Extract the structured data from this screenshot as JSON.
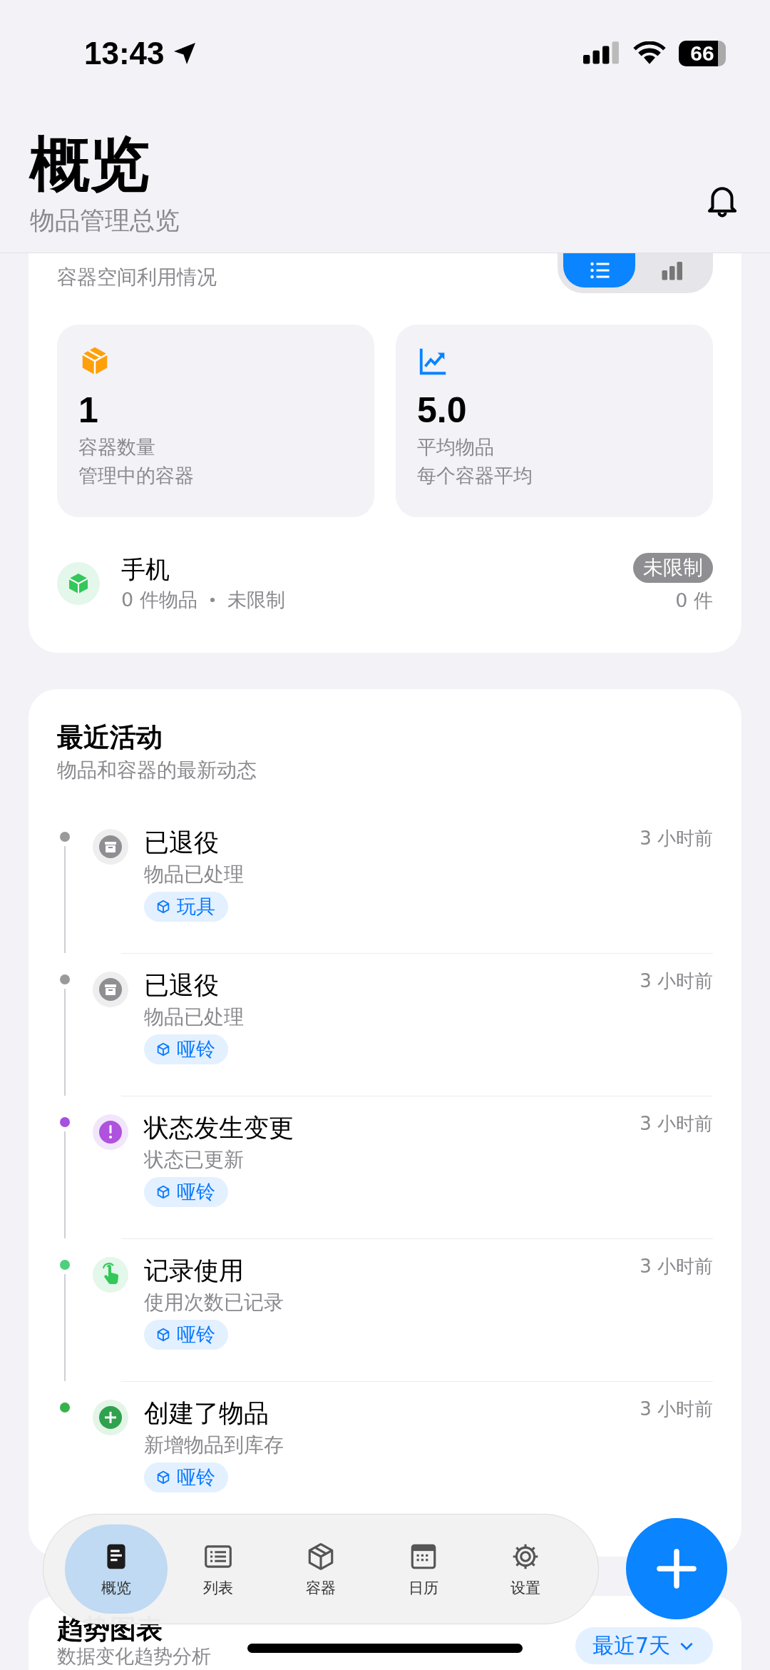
{
  "status_bar": {
    "time": "13:43",
    "battery": "66"
  },
  "header": {
    "title": "概览",
    "subtitle": "物品管理总览"
  },
  "usage_card": {
    "subtitle": "容器空间利用情况",
    "view_toggle": [
      {
        "kind": "list",
        "selected": true
      },
      {
        "kind": "chart",
        "selected": false
      }
    ],
    "stats": [
      {
        "kind": "box",
        "value": "1",
        "label": "容器数量",
        "sublabel": "管理中的容器"
      },
      {
        "kind": "trend",
        "value": "5.0",
        "label": "平均物品",
        "sublabel": "每个容器平均"
      }
    ],
    "containers": [
      {
        "name": "手机",
        "count_text": "0 件物品",
        "limit_text": "未限制",
        "badge": "未限制",
        "count": "0 件"
      }
    ]
  },
  "activity": {
    "title": "最近活动",
    "subtitle": "物品和容器的最新动态",
    "items": [
      {
        "kind": "retired",
        "color": "#9a9a9a",
        "title": "已退役",
        "detail": "物品已处理",
        "tag": "玩具",
        "time": "3 小时前"
      },
      {
        "kind": "retired",
        "color": "#9a9a9a",
        "title": "已退役",
        "detail": "物品已处理",
        "tag": "哑铃",
        "time": "3 小时前"
      },
      {
        "kind": "status",
        "color": "#a550e0",
        "title": "状态发生变更",
        "detail": "状态已更新",
        "tag": "哑铃",
        "time": "3 小时前"
      },
      {
        "kind": "usage",
        "color": "#4cd07d",
        "title": "记录使用",
        "detail": "使用次数已记录",
        "tag": "哑铃",
        "time": "3 小时前"
      },
      {
        "kind": "created",
        "color": "#34b34a",
        "title": "创建了物品",
        "detail": "新增物品到库存",
        "tag": "哑铃",
        "time": "3 小时前"
      }
    ]
  },
  "tab_bar": [
    {
      "kind": "overview",
      "label": "概览",
      "selected": true
    },
    {
      "kind": "list",
      "label": "列表",
      "selected": false
    },
    {
      "kind": "container",
      "label": "容器",
      "selected": false
    },
    {
      "kind": "calendar",
      "label": "日历",
      "selected": false
    },
    {
      "kind": "settings",
      "label": "设置",
      "selected": false
    }
  ],
  "trend_card": {
    "title": "趋势图表",
    "subtitle": "数据变化趋势分析",
    "range": "最近7天"
  }
}
